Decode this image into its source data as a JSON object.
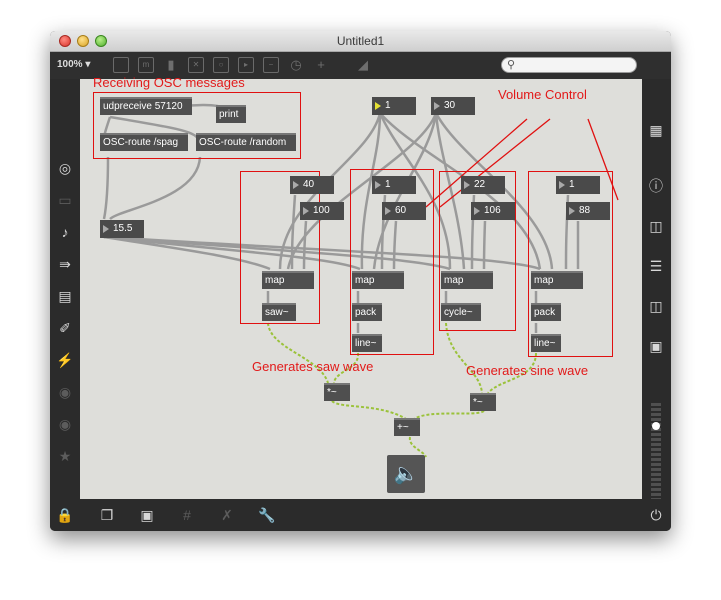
{
  "window": {
    "title": "Untitled1"
  },
  "toolbar": {
    "zoom": "100% ▾"
  },
  "search": {
    "placeholder": ""
  },
  "objects": {
    "udpreceive": "udpreceive 57120",
    "print": "print",
    "route_spag": "OSC-route /spag",
    "route_random": "OSC-route /random",
    "map1": "map",
    "map2": "map",
    "map3": "map",
    "map4": "map",
    "saw": "saw~",
    "pack1": "pack",
    "pack2": "pack",
    "line1": "line~",
    "line2": "line~",
    "cycle": "cycle~",
    "mult1": "*~",
    "mult2": "*~",
    "plus": "+~"
  },
  "numbers": {
    "n_top1": "1",
    "n_top2": "30",
    "n_15_5": "15.5",
    "n_40": "40",
    "n_100": "100",
    "n_1a": "1",
    "n_60": "60",
    "n_22": "22",
    "n_106": "106",
    "n_1b": "1",
    "n_88": "88"
  },
  "annotations": {
    "receiving": "Receiving OSC messages",
    "volume": "Volume Control",
    "saw_label": "Generates saw wave",
    "sine_label": "Generates sine wave"
  },
  "colors": {
    "annotation": "#e21a1a",
    "patchcord_signal": "#9bc23a",
    "canvas": "#dededa"
  }
}
